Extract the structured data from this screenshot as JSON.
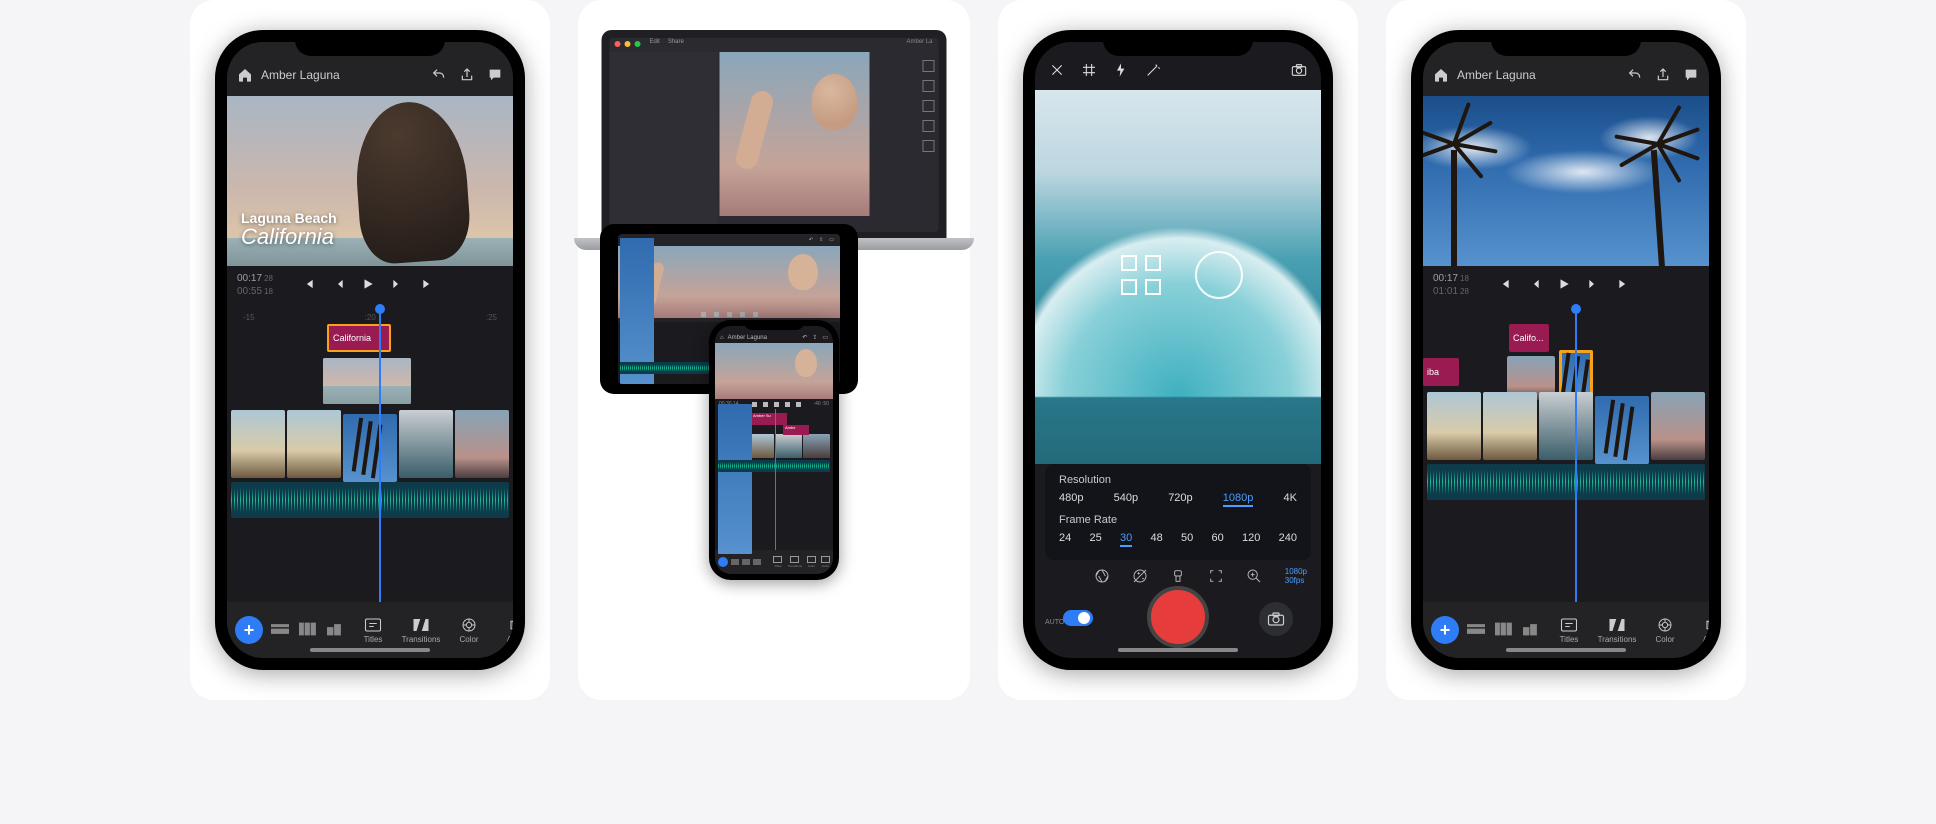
{
  "phone1": {
    "project_name": "Amber Laguna",
    "overlay": {
      "line1": "Laguna Beach",
      "line2": "California"
    },
    "current_time": "00:17",
    "current_frame": "28",
    "total_time": "00:55",
    "total_frame": "18",
    "ruler": [
      "-15",
      ":20",
      ":25"
    ],
    "title_clip": "California",
    "bottom": {
      "titles": "Titles",
      "transitions": "Transitions",
      "color": "Color",
      "audio": "Audio"
    }
  },
  "phone4": {
    "project_name": "Amber Laguna",
    "current_time": "00:17",
    "current_frame": "18",
    "total_time": "01:01",
    "total_frame": "28",
    "title_clip": "Califo...",
    "title_clip2": "iba",
    "bottom": {
      "titles": "Titles",
      "transitions": "Transitions",
      "color": "Color",
      "audio": "Audio"
    }
  },
  "camera": {
    "resolution_label": "Resolution",
    "resolutions": [
      "480p",
      "540p",
      "720p",
      "1080p",
      "4K"
    ],
    "resolution_selected": "1080p",
    "framerate_label": "Frame Rate",
    "framerates": [
      "24",
      "25",
      "30",
      "48",
      "50",
      "60",
      "120",
      "240"
    ],
    "framerate_selected": "30",
    "info_top": "1080p",
    "info_bottom": "30fps",
    "auto_label": "AUTO"
  },
  "devices": {
    "mac_menu": {
      "edit": "Edit",
      "share": "Share"
    },
    "mac_project": "Amber La",
    "mini": {
      "project_name": "Amber Laguna",
      "t1": "00:30",
      "f1": "14",
      "t2": ":40",
      "f2": ":50",
      "title_clip": "Amber Su",
      "title_clip2": "Ambe",
      "bottom": {
        "titles": "Titles",
        "transitions": "Transitions",
        "color": "Color",
        "audio": "Audio"
      }
    }
  }
}
